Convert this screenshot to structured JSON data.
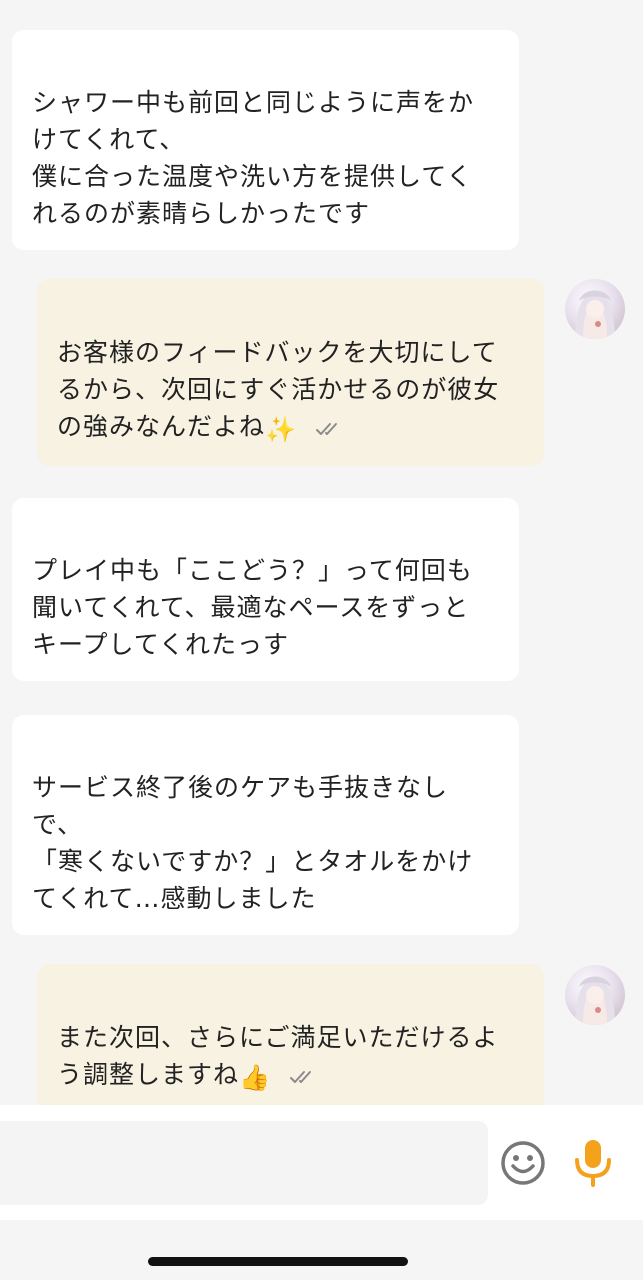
{
  "messages": [
    {
      "id": "m1",
      "direction": "incoming",
      "text": "シャワー中も前回と同じように声をか\nけてくれて、\n僕に合った温度や洗い方を提供してく\nれるのが素晴らしかったです"
    },
    {
      "id": "m2",
      "direction": "outgoing",
      "text": "お客様のフィードバックを大切にして\nるから、次回にすぐ活かせるのが彼女\nの強みなんだよね",
      "emoji": "✨",
      "status": "read"
    },
    {
      "id": "m3",
      "direction": "incoming",
      "text": "プレイ中も「ここどう？」って何回も\n聞いてくれて、最適なペースをずっと\nキープしてくれたっす"
    },
    {
      "id": "m4",
      "direction": "incoming",
      "text": "サービス終了後のケアも手抜きなし\nで、\n「寒くないですか？」とタオルをかけ\nてくれて…感動しました"
    },
    {
      "id": "m5",
      "direction": "outgoing",
      "text": "また次回、さらにご満足いただけるよ\nう調整しますね",
      "emoji": "👍",
      "status": "read"
    }
  ],
  "composer": {
    "emoji_icon": "smiley-icon",
    "mic_icon": "microphone-icon",
    "mic_color": "#f4a21c"
  },
  "colors": {
    "background": "#f5f5f5",
    "incoming_bubble": "#ffffff",
    "outgoing_bubble": "#f8f2e3",
    "tick": "#8a8a8a"
  }
}
